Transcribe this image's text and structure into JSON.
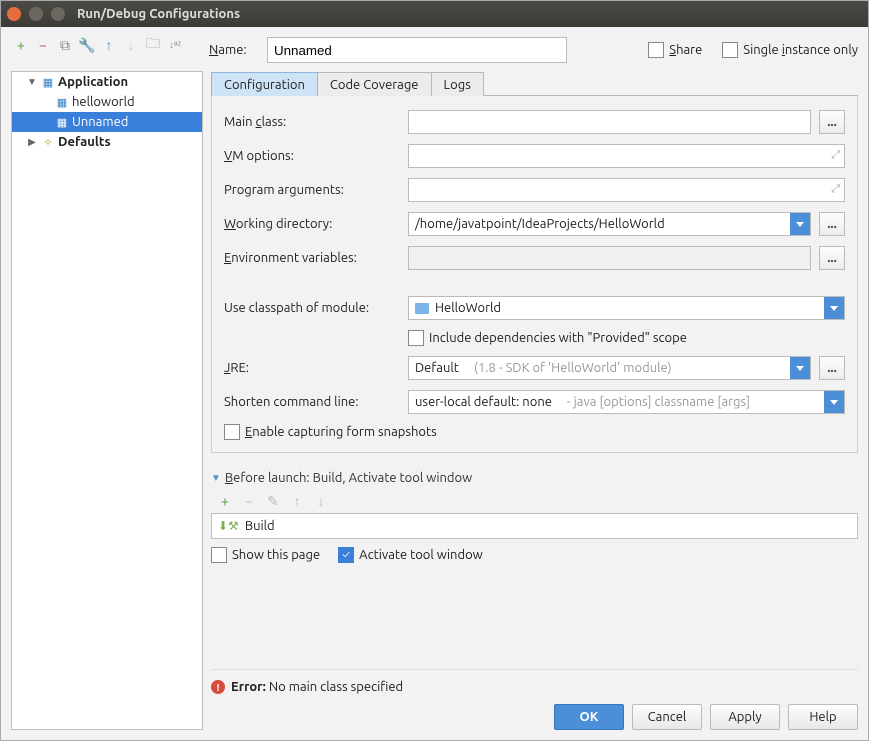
{
  "window": {
    "title": "Run/Debug Configurations"
  },
  "toolbar_icons": [
    "add",
    "remove",
    "copy",
    "wrench",
    "up",
    "down",
    "folder",
    "sort"
  ],
  "tree": {
    "application": {
      "label": "Application"
    },
    "items": [
      {
        "label": "helloworld",
        "selected": false
      },
      {
        "label": "Unnamed",
        "selected": true
      }
    ],
    "defaults": {
      "label": "Defaults"
    }
  },
  "name": {
    "label": "Name:",
    "value": "Unnamed"
  },
  "share": {
    "label": "Share",
    "checked": false
  },
  "single_instance": {
    "label": "Single instance only",
    "checked": false
  },
  "tabs": [
    {
      "label": "Configuration",
      "active": true
    },
    {
      "label": "Code Coverage",
      "active": false
    },
    {
      "label": "Logs",
      "active": false
    }
  ],
  "config": {
    "main_class": {
      "label_pre": "Main ",
      "label_u": "c",
      "label_post": "lass:",
      "value": ""
    },
    "vm_options": {
      "label_u": "V",
      "label_post": "M options:",
      "value": ""
    },
    "program_args": {
      "label_pre": "Program ar",
      "label_u": "g",
      "label_post": "uments:",
      "value": ""
    },
    "working_dir": {
      "label_u": "W",
      "label_post": "orking directory:",
      "value": "/home/javatpoint/IdeaProjects/HelloWorld"
    },
    "env_vars": {
      "label_u": "E",
      "label_post": "nvironment variables:",
      "value": ""
    },
    "classpath": {
      "label": "Use classpath of module:",
      "value": "HelloWorld"
    },
    "include_provided": {
      "label": "Include dependencies with \"Provided\" scope",
      "checked": false
    },
    "jre": {
      "label_u": "J",
      "label_post": "RE:",
      "value": "Default",
      "hint": "(1.8 - SDK of 'HelloWorld' module)"
    },
    "shorten": {
      "label": "Shorten command line:",
      "value": "user-local default: none",
      "hint": "- java [options] classname [args]"
    },
    "enable_capture": {
      "label_u": "E",
      "label_post": "nable capturing form snapshots",
      "checked": false
    }
  },
  "before_launch": {
    "header_u": "B",
    "header_post": "efore launch: Build, Activate tool window",
    "item": "Build",
    "show_this_page": {
      "label": "Show this page",
      "checked": false
    },
    "activate_tool": {
      "label": "Activate tool window",
      "checked": true
    }
  },
  "error": {
    "label": "Error:",
    "text": "No main class specified"
  },
  "buttons": {
    "ok": "OK",
    "cancel": "Cancel",
    "apply": "Apply",
    "help": "Help"
  }
}
